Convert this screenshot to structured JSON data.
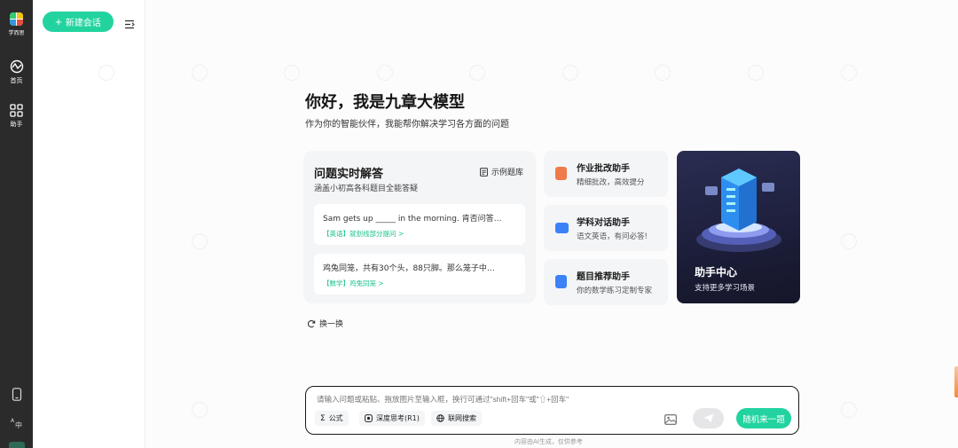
{
  "brand": {
    "name": "学而思"
  },
  "rail": {
    "items": [
      {
        "label": "首页",
        "icon": "pulse-icon"
      },
      {
        "label": "助手",
        "icon": "grid-icon"
      }
    ],
    "bottom_icons": [
      "mobile-icon",
      "language-icon"
    ]
  },
  "sidebar": {
    "new_chat_label": "新建会话"
  },
  "main": {
    "greeting": "你好，我是九章大模型",
    "intro": "作为你的智能伙伴，我能帮你解决学习各方面的问题",
    "qa_card": {
      "title": "问题实时解答",
      "description": "涵盖小初高各科题目全能答疑",
      "sample_link": "示例题库",
      "questions": [
        {
          "text": "Sam gets up _____ in the morning. 肯否问答…",
          "tag": "【英语】就划线部分提问 >"
        },
        {
          "text": "鸡兔同笼，共有30个头，88只脚。那么笼子中…",
          "tag": "【数学】鸡兔同笼 >"
        }
      ]
    },
    "assistants": [
      {
        "title": "作业批改助手",
        "desc": "精细批改，高效提分",
        "color": "#f07a4a"
      },
      {
        "title": "学科对话助手",
        "desc": "语文英语，有问必答!",
        "color": "#3b82f6"
      },
      {
        "title": "题目推荐助手",
        "desc": "你的数学练习定制专家",
        "color": "#3b82f6"
      }
    ],
    "hub": {
      "title": "助手中心",
      "desc": "支持更多学习场景"
    },
    "refresh_label": "换一换"
  },
  "composer": {
    "placeholder": "请输入问题或粘贴、拖放图片至输入框，换行可通过\"shift+回车\"或\"⇧+回车\"",
    "formula_label": "公式",
    "deep_think_label": "深度思考(R1)",
    "web_search_label": "联网搜索",
    "random_label": "随机来一题"
  },
  "footer_note": "内容由AI生成，仅供参考",
  "colors": {
    "accent": "#22d3a0",
    "rail_bg": "#2b2b2b",
    "hub_bg": "#1c1e3a"
  }
}
